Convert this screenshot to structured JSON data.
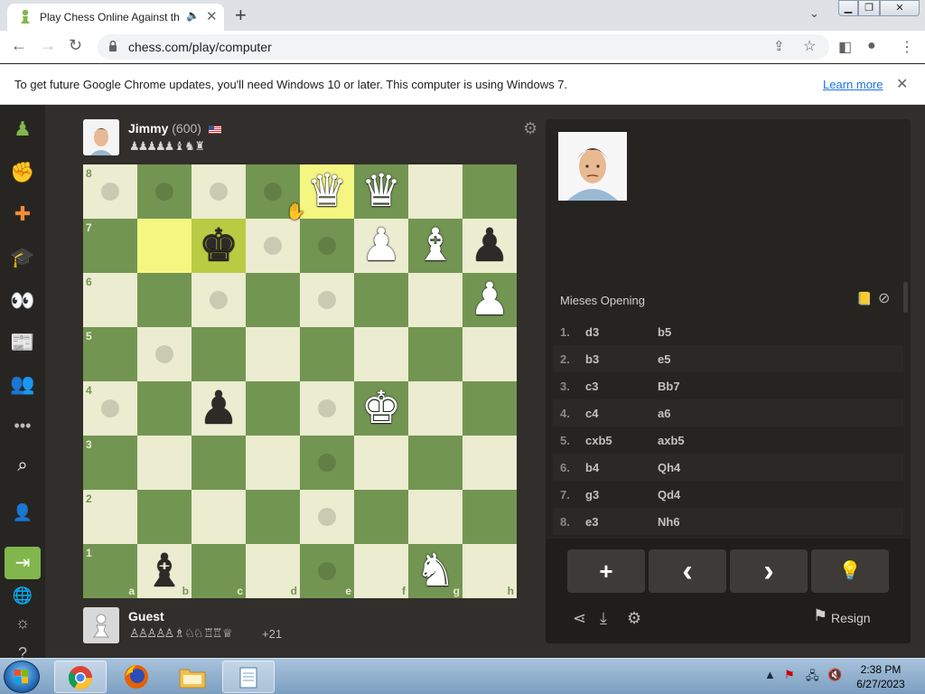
{
  "browser": {
    "tab_title": "Play Chess Online Against th",
    "url": "chess.com/play/computer",
    "new_tab_symbol": "+",
    "info_bar": {
      "message": "To get future Google Chrome updates, you'll need Windows 10 or later. This computer is using Windows 7.",
      "link": "Learn more"
    }
  },
  "opponent": {
    "name": "Jimmy",
    "rating": "(600)",
    "captured": "♟♟♟♟♟ ♝ ♞ ♜"
  },
  "player": {
    "name": "Guest",
    "captured": "♙♙♙♙♙ ♗ ♘♘ ♖♖ ♕",
    "advantage": "+21"
  },
  "board": {
    "files": [
      "a",
      "b",
      "c",
      "d",
      "e",
      "f",
      "g",
      "h"
    ],
    "ranks": [
      "8",
      "7",
      "6",
      "5",
      "4",
      "3",
      "2",
      "1"
    ],
    "highlighted": [
      "e8",
      "b7",
      "c7"
    ],
    "move_hints": [
      "a8",
      "b8",
      "c8",
      "d8",
      "d7",
      "e7",
      "c6",
      "e6",
      "b5",
      "a4",
      "e4",
      "e3",
      "e2",
      "e1"
    ],
    "pieces": [
      {
        "square": "e8",
        "glyph": "♛",
        "color": "white"
      },
      {
        "square": "f8",
        "glyph": "♛",
        "color": "white"
      },
      {
        "square": "c7",
        "glyph": "♚",
        "color": "black"
      },
      {
        "square": "f7",
        "glyph": "♟",
        "color": "white"
      },
      {
        "square": "g7",
        "glyph": "♝",
        "color": "white"
      },
      {
        "square": "h7",
        "glyph": "♟",
        "color": "black"
      },
      {
        "square": "h6",
        "glyph": "♟",
        "color": "white"
      },
      {
        "square": "c4",
        "glyph": "♟",
        "color": "black"
      },
      {
        "square": "f4",
        "glyph": "♚",
        "color": "white"
      },
      {
        "square": "b1",
        "glyph": "♝",
        "color": "black"
      },
      {
        "square": "g1",
        "glyph": "♞",
        "color": "white"
      }
    ],
    "colors": {
      "light": "#ebecd0",
      "dark": "#739552",
      "highlight_light": "#f5f682",
      "highlight_dark": "#b9ca43"
    }
  },
  "panel": {
    "opening_name": "Mieses Opening",
    "moves": [
      {
        "num": "1.",
        "white": "d3",
        "black": "b5"
      },
      {
        "num": "2.",
        "white": "b3",
        "black": "e5"
      },
      {
        "num": "3.",
        "white": "c3",
        "black": "Bb7"
      },
      {
        "num": "4.",
        "white": "c4",
        "black": "a6"
      },
      {
        "num": "5.",
        "white": "cxb5",
        "black": "axb5"
      },
      {
        "num": "6.",
        "white": "b4",
        "black": "Qh4"
      },
      {
        "num": "7.",
        "white": "g3",
        "black": "Qd4"
      },
      {
        "num": "8.",
        "white": "e3",
        "black": "Nh6"
      }
    ],
    "controls": {
      "new": "+",
      "prev": "‹",
      "next": "›",
      "hint": "💡"
    },
    "resign_label": "Resign"
  },
  "taskbar": {
    "time": "2:38 PM",
    "date": "6/27/2023"
  },
  "accent": "#81b64c"
}
